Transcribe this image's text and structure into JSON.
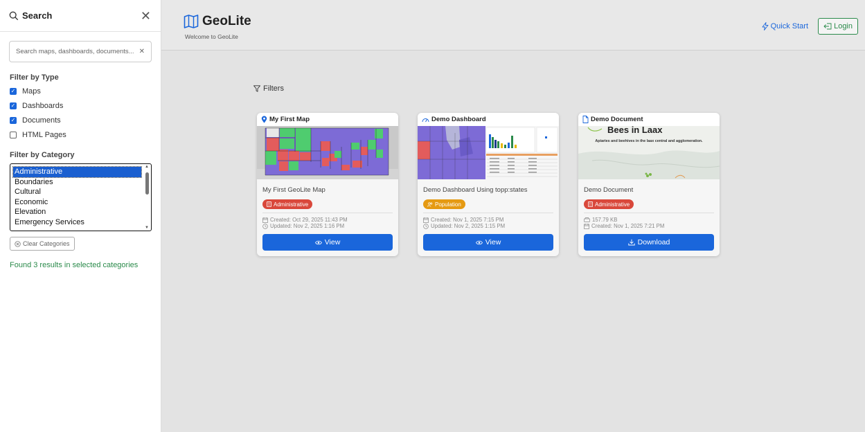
{
  "sidebar": {
    "title": "Search",
    "search_placeholder": "Search maps, dashboards, documents...",
    "filter_type_label": "Filter by Type",
    "types": [
      {
        "label": "Maps",
        "checked": true
      },
      {
        "label": "Dashboards",
        "checked": true
      },
      {
        "label": "Documents",
        "checked": true
      },
      {
        "label": "HTML Pages",
        "checked": false
      }
    ],
    "filter_category_label": "Filter by Category",
    "categories": [
      "Administrative",
      "Boundaries",
      "Cultural",
      "Economic",
      "Elevation",
      "Emergency Services"
    ],
    "selected_category": "Administrative",
    "clear_label": "Clear Categories",
    "results_text": "Found 3 results in selected categories"
  },
  "header": {
    "brand": "GeoLite",
    "subtitle": "Welcome to GeoLite",
    "quick_start": "Quick Start",
    "login": "Login"
  },
  "main": {
    "filters_label": "Filters",
    "cards": [
      {
        "type_label": "My First Map",
        "icon": "map-pin-icon",
        "title": "My First GeoLite Map",
        "badge": "Administrative",
        "badge_color": "#d9483b",
        "meta1": "Created: Oct 29, 2025 11:43 PM",
        "meta2": "Updated: Nov 2, 2025 1:16 PM",
        "button": "View"
      },
      {
        "type_label": "Demo Dashboard",
        "icon": "dashboard-icon",
        "title": "Demo Dashboard Using topp:states",
        "badge": "Population",
        "badge_color": "#e59a12",
        "meta1": "Created: Nov 1, 2025 7:15 PM",
        "meta2": "Updated: Nov 2, 2025 1:15 PM",
        "button": "View"
      },
      {
        "type_label": "Demo Document",
        "icon": "document-icon",
        "title": "Demo Document",
        "badge": "Administrative",
        "badge_color": "#d9483b",
        "thumb_heading": "Bees in Laax",
        "thumb_sub": "Apiaries and beehives in the laax central and agglomeration.",
        "meta1": "157.79 KB",
        "meta2": "Created: Nov 1, 2025 7:21 PM",
        "button": "Download"
      }
    ]
  },
  "colors": {
    "primary": "#1a66db",
    "success": "#2a8a4a"
  }
}
